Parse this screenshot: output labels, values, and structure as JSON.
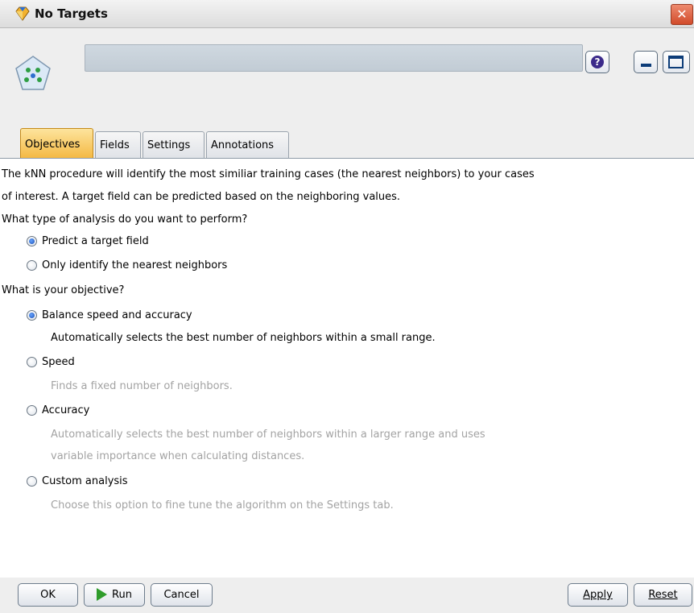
{
  "window": {
    "title": "No Targets",
    "close_glyph": "✕"
  },
  "header": {
    "name_field_value": "",
    "help_glyph": "?"
  },
  "tabs": [
    {
      "label": "Objectives",
      "active": true
    },
    {
      "label": "Fields",
      "active": false
    },
    {
      "label": "Settings",
      "active": false
    },
    {
      "label": "Annotations",
      "active": false
    }
  ],
  "objectives": {
    "intro_line1": "The kNN procedure will identify the most similiar training cases (the nearest neighbors) to your cases",
    "intro_line2": "of interest. A target field can be predicted based on the neighboring values.",
    "analysis_question": "What type of analysis do you want to perform?",
    "analysis_options": [
      {
        "label": "Predict a target field",
        "selected": true
      },
      {
        "label": "Only identify the nearest neighbors",
        "selected": false
      }
    ],
    "objective_question": "What is your objective?",
    "objective_options": [
      {
        "label": "Balance speed and accuracy",
        "selected": true,
        "description": "Automatically selects the best number of neighbors within a small range."
      },
      {
        "label": "Speed",
        "selected": false,
        "description": "Finds a fixed number of neighbors."
      },
      {
        "label": "Accuracy",
        "selected": false,
        "description_line1": "Automatically selects the best number of neighbors within a larger range and uses",
        "description_line2": "variable importance when calculating distances."
      },
      {
        "label": "Custom analysis",
        "selected": false,
        "description": "Choose this option to fine tune the algorithm on the Settings tab."
      }
    ]
  },
  "footer": {
    "ok": "OK",
    "run": "Run",
    "cancel": "Cancel",
    "apply": "Apply",
    "reset": "Reset"
  },
  "colors": {
    "active_tab": "#f4b944",
    "selected_radio": "#1a4fb3",
    "disabled_text": "#a3a3a3",
    "run_arrow": "#2f9c2b",
    "close_button": "#d14b2b"
  },
  "icons": {
    "app": "diamond-app-icon",
    "node": "knn-node-icon",
    "help": "help-icon",
    "minimize": "minimize-icon",
    "maximize": "maximize-icon",
    "close": "close-icon",
    "run": "run-arrow-icon"
  }
}
